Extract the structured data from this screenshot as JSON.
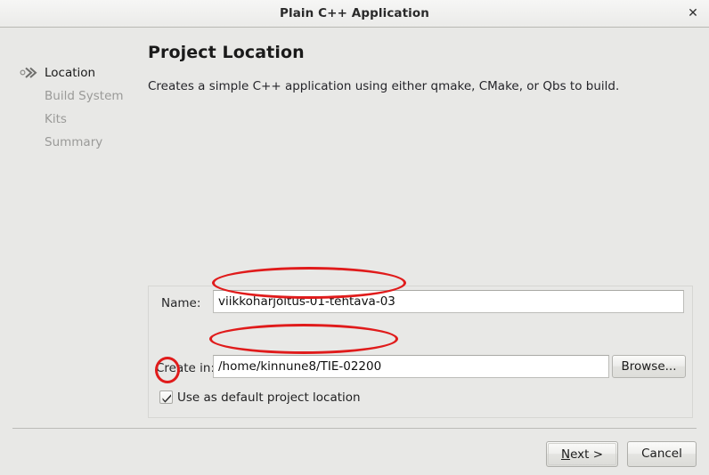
{
  "window": {
    "title": "Plain C++ Application",
    "close_icon": "close-icon",
    "close_glyph": "✕"
  },
  "sidebar": {
    "items": [
      {
        "label": "Location",
        "state": "active",
        "icon": "double-chevron-right-icon"
      },
      {
        "label": "Build System",
        "state": "disabled",
        "icon": ""
      },
      {
        "label": "Kits",
        "state": "disabled",
        "icon": ""
      },
      {
        "label": "Summary",
        "state": "disabled",
        "icon": ""
      }
    ]
  },
  "main": {
    "title": "Project Location",
    "description": "Creates a simple C++ application using either qmake, CMake, or Qbs to build."
  },
  "form": {
    "name": {
      "label": "Name:",
      "value": "viikkoharjoitus-01-tehtava-03",
      "placeholder": ""
    },
    "create_in": {
      "label": "Create in:",
      "value": "/home/kinnune8/TIE-02200",
      "placeholder": ""
    },
    "browse_label": "Browse...",
    "default_location": {
      "label": "Use as default project location",
      "checked": true,
      "check_glyph": "✔"
    }
  },
  "footer": {
    "next_label_prefix": "N",
    "next_label_rest": "ext >",
    "next_label": "Next >",
    "cancel_label": "Cancel"
  },
  "annotations": {
    "color": "#e01b1b",
    "shapes": [
      {
        "name": "name-value-highlight",
        "target": "form.name.value"
      },
      {
        "name": "create-in-value-highlight",
        "target": "form.create_in.value"
      },
      {
        "name": "checkbox-highlight",
        "target": "form.default_location.checked"
      }
    ]
  },
  "colors": {
    "window_background": "#e8e8e6",
    "titlebar_background": "#f2f2f0",
    "input_background": "#ffffff",
    "text": "#1c1c1c",
    "disabled_text": "#9a9a98",
    "annotation_red": "#e01b1b"
  }
}
